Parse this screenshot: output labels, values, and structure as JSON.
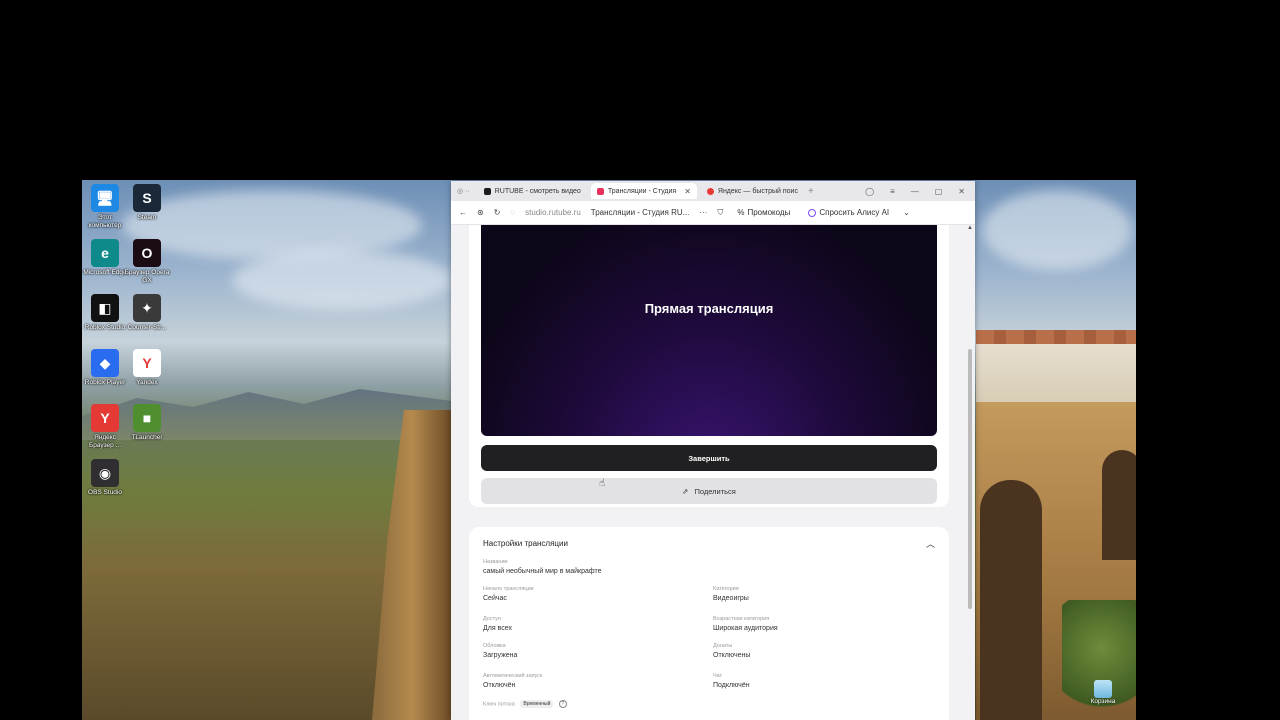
{
  "desktop": {
    "icons": [
      {
        "label": "Этот компьютер",
        "glyph": "🖥",
        "color": "#1e88e5",
        "icon": "computer-icon"
      },
      {
        "label": "Steam",
        "glyph": "S",
        "color": "#1b2838",
        "icon": "steam-icon"
      },
      {
        "label": "Microsoft Edge",
        "glyph": "e",
        "color": "#0f8a8a",
        "icon": "edge-icon"
      },
      {
        "label": "Браузер Opera GX",
        "glyph": "O",
        "color": "#1a0b14",
        "icon": "opera-gx-icon"
      },
      {
        "label": "Roblox Studio",
        "glyph": "◧",
        "color": "#111111",
        "icon": "roblox-studio-icon"
      },
      {
        "label": "Counter-Str...",
        "glyph": "✦",
        "color": "#3a3a3a",
        "icon": "counter-strike-icon"
      },
      {
        "label": "Roblox Player",
        "glyph": "◆",
        "color": "#2a6cf0",
        "icon": "roblox-player-icon"
      },
      {
        "label": "Yandex",
        "glyph": "Y",
        "color": "#ffffff",
        "icon": "yandex-icon"
      },
      {
        "label": "Яндекс Браузер ...",
        "glyph": "Y",
        "color": "#e53935",
        "icon": "yandex-browser-icon"
      },
      {
        "label": "TLauncher",
        "glyph": "■",
        "color": "#4f8f2f",
        "icon": "tlauncher-icon"
      },
      {
        "label": "OBS Studio",
        "glyph": "◉",
        "color": "#302e31",
        "icon": "obs-icon"
      }
    ],
    "recycle_label": "Корзина"
  },
  "browser": {
    "tabs": [
      {
        "label": "RUTUBE - смотреть видео",
        "fav_color": "#1c1c1c",
        "active": false
      },
      {
        "label": "Трансляции - Студия",
        "fav_color": "#e8305a",
        "active": true
      },
      {
        "label": "Яндекс — быстрый поис",
        "fav_color": "#e53935",
        "active": false
      }
    ],
    "url": "studio.rutube.ru",
    "page_title": "Трансляции - Студия RU...",
    "more": "···",
    "promocodes": "Промокоды",
    "ask_alice": "Спросить Алису AI"
  },
  "player": {
    "overlay_text": "Прямая трансляция"
  },
  "actions": {
    "end_label": "Завершить",
    "share_label": "Поделиться"
  },
  "settings": {
    "title": "Настройки трансляции",
    "fields": {
      "name": {
        "k": "Название",
        "v": "самый необычный мир в майкрафте"
      },
      "start": {
        "k": "Начало трансляции",
        "v": "Сейчас"
      },
      "category": {
        "k": "Категория",
        "v": "Видеоигры"
      },
      "access": {
        "k": "Доступ",
        "v": "Для всех"
      },
      "age": {
        "k": "Возрастная категория",
        "v": "Широкая аудитория"
      },
      "cover": {
        "k": "Обложка",
        "v": "Загружена"
      },
      "donations": {
        "k": "Донаты",
        "v": "Отключены"
      },
      "autostart": {
        "k": "Автоматический запуск",
        "v": "Отключён"
      },
      "chat": {
        "k": "Чат",
        "v": "Подключён"
      },
      "stream_key": {
        "k": "Ключ потока",
        "badge": "Временный"
      }
    }
  }
}
